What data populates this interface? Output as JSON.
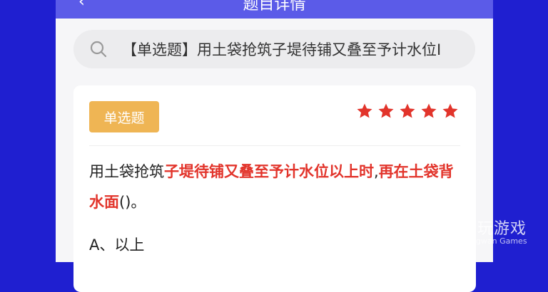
{
  "header": {
    "back_icon": "chevron-left-icon",
    "title": "题目详情"
  },
  "search": {
    "icon": "search-icon",
    "text": "【单选题】用土袋抢筑子堤待铺又叠至予计水位I"
  },
  "card": {
    "badge": "单选题",
    "rating_stars": 5,
    "star_color": "#e2342b",
    "question": {
      "plain_prefix": "用土袋抢筑",
      "highlight_1": "子堤待铺又叠至予计水位以上时",
      "plain_mid": ",",
      "highlight_2": "再在土袋背水面",
      "plain_suffix": "()。"
    },
    "options": [
      "A、以上"
    ]
  },
  "watermark": {
    "name_cn": "仍玩游戏",
    "name_en": "Rengwan Games"
  },
  "colors": {
    "background": "#1f1fd0",
    "header": "#5b5be8",
    "badge": "#efb554",
    "highlight": "#e2342b"
  }
}
